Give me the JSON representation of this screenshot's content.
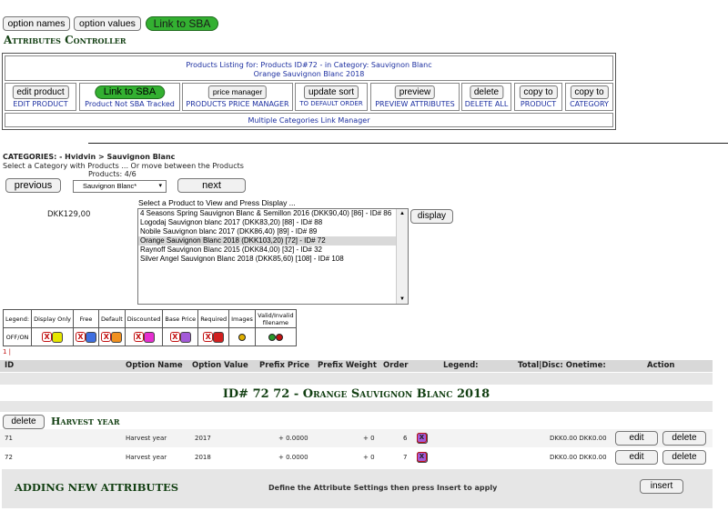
{
  "top_buttons": {
    "option_names": "option names",
    "option_values": "option values",
    "link_to_sba": "Link to SBA"
  },
  "page_title": "Attributes Controller",
  "listing": {
    "line1": "Products Listing for: Products ID#72 - in Category: Sauvignon Blanc",
    "line2": "Orange Sauvignon Blanc 2018"
  },
  "controls": [
    {
      "button": "edit product",
      "label": "EDIT PRODUCT"
    },
    {
      "button": "Link to SBA",
      "label": "Product Not SBA Tracked"
    },
    {
      "button": "price manager",
      "label": "PRODUCTS PRICE MANAGER"
    },
    {
      "button": "update sort",
      "label": "TO DEFAULT ORDER"
    },
    {
      "button": "preview",
      "label": "PREVIEW ATTRIBUTES"
    },
    {
      "button": "delete",
      "label": "DELETE ALL"
    },
    {
      "button": "copy to",
      "label": "PRODUCT"
    },
    {
      "button": "copy to",
      "label": "CATEGORY"
    }
  ],
  "multi_link": "Multiple Categories Link Manager",
  "categories": {
    "path": "CATEGORIES:  - Hvidvin > Sauvignon Blanc",
    "hint": "Select a Category with Products ... Or move between the Products",
    "count": "Products: 4/6"
  },
  "nav": {
    "previous": "previous",
    "next": "next",
    "select_value": "Sauvignon Blanc*"
  },
  "product_select": {
    "prompt": "Select a Product to View and Press Display ...",
    "price": "DKK129,00",
    "display_btn": "display",
    "options": [
      "4 Seasons Spring Sauvignon Blanc & Semillon 2016 (DKK90,40) [86] - ID# 86",
      "Logodaj Sauvignon blanc 2017 (DKK83,20) [88] - ID# 88",
      "Nobile Sauvignon blanc 2017 (DKK86,40) [89] - ID# 89",
      "Orange Sauvignon Blanc 2018 (DKK103,20) [72] - ID# 72",
      "Raynoff Sauvignon Blanc 2015 (DKK84,00) [32] - ID# 32",
      "Silver Angel Sauvignon Blanc 2018 (DKK85,60) [108] - ID# 108"
    ],
    "selected_index": 3
  },
  "legend": {
    "headers": [
      "Legend:",
      "Display Only",
      "Free",
      "Default",
      "Discounted",
      "Base Price",
      "Required",
      "Images",
      "Valid/Invalid filename"
    ],
    "offon": "OFF/ON",
    "colors": [
      "#e6e600",
      "#3f6fe0",
      "#f09020",
      "#e52fd0",
      "#a35ad8",
      "#d11f1f"
    ]
  },
  "marker": "1 |",
  "table_headers": {
    "id": "ID",
    "option_name": "Option Name",
    "option_value": "Option Value",
    "prefix_price": "Prefix Price",
    "prefix_weight": "Prefix Weight",
    "order": "Order",
    "legend": "Legend:",
    "total": "Total|Disc: Onetime:",
    "action": "Action"
  },
  "product_heading": "ID# 72 72 - Orange Sauvignon Blanc 2018",
  "option_group": {
    "delete": "delete",
    "name": "Harvest year"
  },
  "rows": [
    {
      "id": "71",
      "name": "Harvest year",
      "value": "2017",
      "price": "+ 0.0000",
      "weight": "+ 0",
      "order": "6",
      "total": "DKK0.00 DKK0.00",
      "edit": "edit",
      "delete": "delete"
    },
    {
      "id": "72",
      "name": "Harvest year",
      "value": "2018",
      "price": "+ 0.0000",
      "weight": "+ 0",
      "order": "7",
      "total": "DKK0.00 DKK0.00",
      "edit": "edit",
      "delete": "delete"
    }
  ],
  "adding": {
    "title": "ADDING NEW ATTRIBUTES",
    "hint": "Define the Attribute Settings then press Insert to apply",
    "insert": "insert"
  }
}
